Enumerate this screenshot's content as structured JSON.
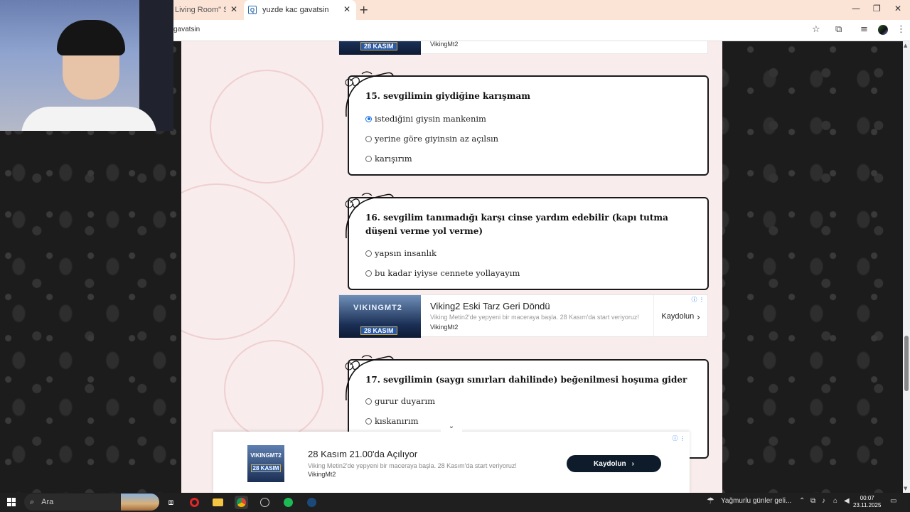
{
  "browser": {
    "tabs": [
      {
        "title": "Living Room\" Sound",
        "active": false
      },
      {
        "title": "yuzde kac gavatsin",
        "active": true
      }
    ],
    "address": "gavatsin",
    "new_tab": "+",
    "window_minimize": "—",
    "window_restore": "❐",
    "window_close": "✕",
    "icons": [
      "bookmark-star-icon",
      "extensions-icon",
      "media-icon",
      "profile-avatar",
      "menu-icon"
    ]
  },
  "ad_top": {
    "brand": "VikingMt2",
    "badge": "28 KASIM"
  },
  "questions": [
    {
      "number": "15.",
      "title": "sevgilimin giydiğine karışmam",
      "options": [
        {
          "label": "istediğini giysin mankenim",
          "checked": true
        },
        {
          "label": "yerine göre giyinsin az açılsın",
          "checked": false
        },
        {
          "label": "karışırım",
          "checked": false
        }
      ]
    },
    {
      "number": "16.",
      "title": "sevgilim tanımadığı karşı cinse yardım edebilir (kapı tutma düşeni verme yol verme)",
      "options": [
        {
          "label": "yapsın insanlık",
          "checked": false
        },
        {
          "label": "bu kadar iyiyse cennete yollayayım",
          "checked": false
        }
      ]
    },
    {
      "number": "17.",
      "title": "sevgilimin (saygı sınırları dahilinde) beğenilmesi hoşuma gider",
      "options": [
        {
          "label": "gurur duyarım",
          "checked": false
        },
        {
          "label": "kıskanırım",
          "checked": false
        }
      ]
    }
  ],
  "ad_inline": {
    "image_logo": "VIKINGMT2",
    "image_badge": "28 KASIM",
    "title": "Viking2 Eski Tarz Geri Döndü",
    "description": "Viking Metin2'de yepyeni bir maceraya başla. 28 Kasım'da start veriyoruz!",
    "brand": "VikingMt2",
    "cta": "Kaydolun"
  },
  "ad_bottom": {
    "image_logo": "VIKINGMT2",
    "image_badge": "28 KASIM",
    "title": "28 Kasım 21.00'da Açılıyor",
    "description": "Viking Metin2'de yepyeni bir maceraya başla. 28 Kasım'da start veriyoruz!",
    "brand": "VikingMt2",
    "cta": "Kaydolun"
  },
  "taskbar": {
    "search_placeholder": "Ara",
    "weather": "Yağmurlu günler geli...",
    "time": "00:07",
    "date": "23.11.2025"
  },
  "colors": {
    "accent_blue": "#1a73e8",
    "page_bg": "#f8ecec",
    "card_border": "#1a1a1a",
    "cta_dark": "#0d1b2a"
  }
}
